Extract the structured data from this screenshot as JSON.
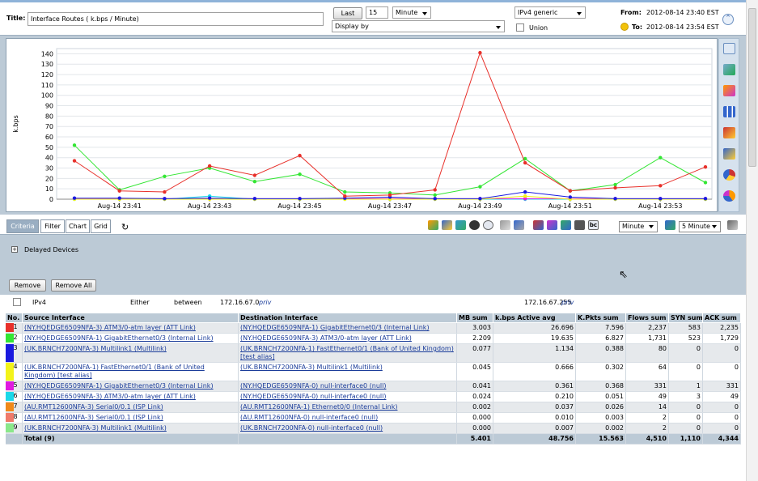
{
  "header": {
    "title_label": "Title:",
    "title_value": "Interface Routes ( k.bps / Minute)",
    "last_button": "Last",
    "last_count": "15",
    "time_unit": "Minute",
    "display_by": "Display by",
    "ip_version": "IPv4 generic",
    "union_label": "Union",
    "from_label": "From:",
    "from_value": "2012-08-14 23:40 EST",
    "to_label": "To:",
    "to_value": "2012-08-14 23:54 EST"
  },
  "colors": {
    "panel_bg": "#bccad6",
    "series_red": "#e8302a",
    "series_green": "#33e633",
    "series_blue": "#1a1adf",
    "series_yellow": "#f3f31a",
    "series_magenta": "#e01ae0",
    "series_cyan": "#1ad8e8",
    "series_orange": "#f08a1a",
    "series_salmon": "#f07a6a",
    "series_lightgreen": "#8ae88a",
    "link": "#1a3c9a"
  },
  "chart_data": {
    "type": "line",
    "ylabel": "k.bps",
    "xlabel": "",
    "ylim": [
      0,
      145
    ],
    "yticks": [
      0,
      10,
      20,
      30,
      40,
      50,
      60,
      70,
      80,
      90,
      100,
      110,
      120,
      130,
      140
    ],
    "xtick_labels": [
      "Aug-14 23:41",
      "Aug-14 23:43",
      "Aug-14 23:45",
      "Aug-14 23:47",
      "Aug-14 23:49",
      "Aug-14 23:51",
      "Aug-14 23:53"
    ],
    "x": [
      "23:40",
      "23:41",
      "23:42",
      "23:43",
      "23:44",
      "23:45",
      "23:46",
      "23:47",
      "23:48",
      "23:49",
      "23:50",
      "23:51",
      "23:52",
      "23:53",
      "23:54"
    ],
    "grid": true,
    "legend": "none",
    "series": [
      {
        "color": "#e8302a",
        "values": [
          37,
          8,
          7,
          32,
          23,
          42,
          3,
          4,
          9,
          141,
          35,
          8,
          11,
          13,
          31
        ]
      },
      {
        "color": "#33e633",
        "values": [
          52,
          9,
          22,
          30,
          17,
          24,
          7,
          6,
          4,
          12,
          39,
          8,
          14,
          40,
          16
        ]
      },
      {
        "color": "#1a1adf",
        "values": [
          1,
          1,
          0.5,
          1,
          0.5,
          0.5,
          1,
          2,
          0.5,
          0.5,
          7,
          2,
          0.5,
          0.5,
          0.5
        ]
      },
      {
        "color": "#f3f31a",
        "values": [
          0,
          0,
          0,
          0,
          0,
          0,
          0,
          0,
          0,
          0,
          3,
          0,
          0,
          0,
          0
        ]
      },
      {
        "color": "#e01ae0",
        "values": [
          0.5,
          0.5,
          0.5,
          0.5,
          0.5,
          0.5,
          0.5,
          0.5,
          0.5,
          0.5,
          0.5,
          0.5,
          0.5,
          0.5,
          0.5
        ]
      },
      {
        "color": "#1ad8e8",
        "values": [
          0,
          0,
          0,
          3,
          0,
          0,
          0,
          0,
          0,
          0,
          0,
          0,
          0,
          0,
          0
        ]
      }
    ]
  },
  "tabs": [
    "Criteria",
    "Filter",
    "Chart",
    "Grid"
  ],
  "toolbar": {
    "unit_select": "Minute",
    "interval_select": "5 Minute"
  },
  "criteria": {
    "delayed_devices": "Delayed Devices",
    "remove_button": "Remove",
    "remove_all_button": "Remove All"
  },
  "filter": {
    "protocol": "IPv4",
    "direction": "Either",
    "operator": "between",
    "ip_from": "172.16.67.0",
    "ip_from_tag": "priv",
    "ip_to": "172.16.67.255",
    "ip_to_tag": "priv"
  },
  "table": {
    "headers": [
      "No.",
      "Source Interface",
      "Destination Interface",
      "MB sum",
      "k.bps Active avg",
      "K.Pkts sum",
      "Flows sum",
      "SYN sum",
      "ACK sum"
    ],
    "rows": [
      {
        "no": "1",
        "color": "#e8302a",
        "src": "(NY.HQEDGE6509NFA-3) ATM3/0-atm layer (ATT Link)",
        "dst": "(NY.HQEDGE6509NFA-1) GigabitEthernet0/3 (Internal Link)",
        "mb": "3.003",
        "kbps": "26.696",
        "kpkts": "7.596",
        "flows": "2,237",
        "syn": "583",
        "ack": "2,235"
      },
      {
        "no": "2",
        "color": "#33e633",
        "src": "(NY.HQEDGE6509NFA-1) GigabitEthernet0/3 (Internal Link)",
        "dst": "(NY.HQEDGE6509NFA-3) ATM3/0-atm layer (ATT Link)",
        "mb": "2.209",
        "kbps": "19.635",
        "kpkts": "6.827",
        "flows": "1,731",
        "syn": "523",
        "ack": "1,729"
      },
      {
        "no": "3",
        "color": "#1a1adf",
        "src": "(UK.BRNCH7200NFA-3) Multilink1 (Multilink)",
        "dst": "(UK.BRNCH7200NFA-1) FastEthernet0/1 (Bank of United Kingdom) [test alias]",
        "mb": "0.077",
        "kbps": "1.134",
        "kpkts": "0.388",
        "flows": "80",
        "syn": "0",
        "ack": "0"
      },
      {
        "no": "4",
        "color": "#f3f31a",
        "src": "(UK.BRNCH7200NFA-1) FastEthernet0/1 (Bank of United Kingdom) [test alias]",
        "dst": "(UK.BRNCH7200NFA-3) Multilink1 (Multilink)",
        "mb": "0.045",
        "kbps": "0.666",
        "kpkts": "0.302",
        "flows": "64",
        "syn": "0",
        "ack": "0"
      },
      {
        "no": "5",
        "color": "#e01ae0",
        "src": "(NY.HQEDGE6509NFA-1) GigabitEthernet0/3 (Internal Link)",
        "dst": "(NY.HQEDGE6509NFA-0) null-interface0 (null)",
        "mb": "0.041",
        "kbps": "0.361",
        "kpkts": "0.368",
        "flows": "331",
        "syn": "1",
        "ack": "331"
      },
      {
        "no": "6",
        "color": "#1ad8e8",
        "src": "(NY.HQEDGE6509NFA-3) ATM3/0-atm layer (ATT Link)",
        "dst": "(NY.HQEDGE6509NFA-0) null-interface0 (null)",
        "mb": "0.024",
        "kbps": "0.210",
        "kpkts": "0.051",
        "flows": "49",
        "syn": "3",
        "ack": "49"
      },
      {
        "no": "7",
        "color": "#f08a1a",
        "src": "(AU.RMT12600NFA-3) Serial0/0.1 (ISP Link)",
        "dst": "(AU.RMT12600NFA-1) Ethernet0/0 (Internal Link)",
        "mb": "0.002",
        "kbps": "0.037",
        "kpkts": "0.026",
        "flows": "14",
        "syn": "0",
        "ack": "0"
      },
      {
        "no": "8",
        "color": "#f07a6a",
        "src": "(AU.RMT12600NFA-3) Serial0/0.1 (ISP Link)",
        "dst": "(AU.RMT12600NFA-0) null-interface0 (null)",
        "mb": "0.000",
        "kbps": "0.010",
        "kpkts": "0.003",
        "flows": "2",
        "syn": "0",
        "ack": "0"
      },
      {
        "no": "9",
        "color": "#8ae88a",
        "src": "(UK.BRNCH7200NFA-3) Multilink1 (Multilink)",
        "dst": "(UK.BRNCH7200NFA-0) null-interface0 (null)",
        "mb": "0.000",
        "kbps": "0.007",
        "kpkts": "0.002",
        "flows": "2",
        "syn": "0",
        "ack": "0"
      }
    ],
    "total": {
      "label": "Total (9)",
      "mb": "5.401",
      "kbps": "48.756",
      "kpkts": "15.563",
      "flows": "4,510",
      "syn": "1,110",
      "ack": "4,344"
    }
  }
}
